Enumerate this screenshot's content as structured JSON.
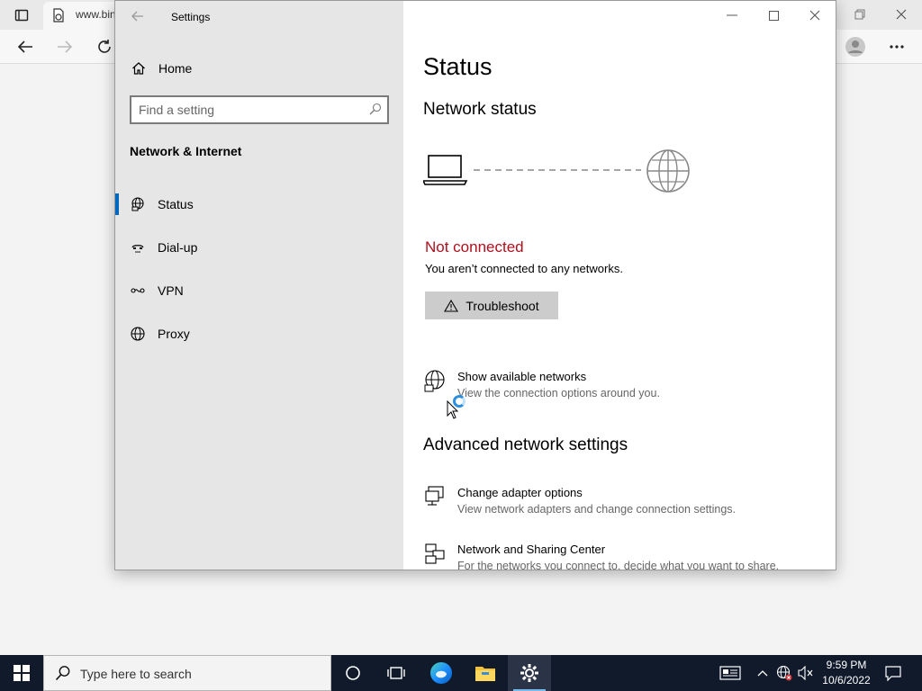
{
  "browser": {
    "tab_title": "www.bin",
    "profile_icon": "avatar-icon",
    "more_icon": "more-dots-icon"
  },
  "settings": {
    "window_title": "Settings",
    "sidebar": {
      "home_label": "Home",
      "search_placeholder": "Find a setting",
      "section_title": "Network & Internet",
      "items": [
        {
          "label": "Status",
          "icon": "globe-ethernet-icon",
          "selected": true
        },
        {
          "label": "Dial-up",
          "icon": "dialup-icon",
          "selected": false
        },
        {
          "label": "VPN",
          "icon": "vpn-icon",
          "selected": false
        },
        {
          "label": "Proxy",
          "icon": "globe-icon",
          "selected": false
        }
      ]
    },
    "main": {
      "page_title": "Status",
      "network_status_heading": "Network status",
      "connection_status": "Not connected",
      "connection_description": "You aren’t connected to any networks.",
      "troubleshoot_label": "Troubleshoot",
      "show_networks": {
        "title": "Show available networks",
        "subtitle": "View the connection options around you."
      },
      "advanced_heading": "Advanced network settings",
      "advanced_links": [
        {
          "title": "Change adapter options",
          "subtitle": "View network adapters and change connection settings.",
          "icon": "adapter-icon"
        },
        {
          "title": "Network and Sharing Center",
          "subtitle": "For the networks you connect to, decide what you want to share.",
          "icon": "sharing-center-icon"
        }
      ]
    }
  },
  "taskbar": {
    "search_placeholder": "Type here to search",
    "apps": [
      "cortana-icon",
      "task-view-icon",
      "edge-icon",
      "file-explorer-icon",
      "settings-gear-icon"
    ],
    "time": "9:59 PM",
    "date": "10/6/2022"
  },
  "colors": {
    "accent": "#0067c0",
    "error": "#b10e1c",
    "taskbar": "#101a2b",
    "sidebar": "#e6e6e6"
  }
}
